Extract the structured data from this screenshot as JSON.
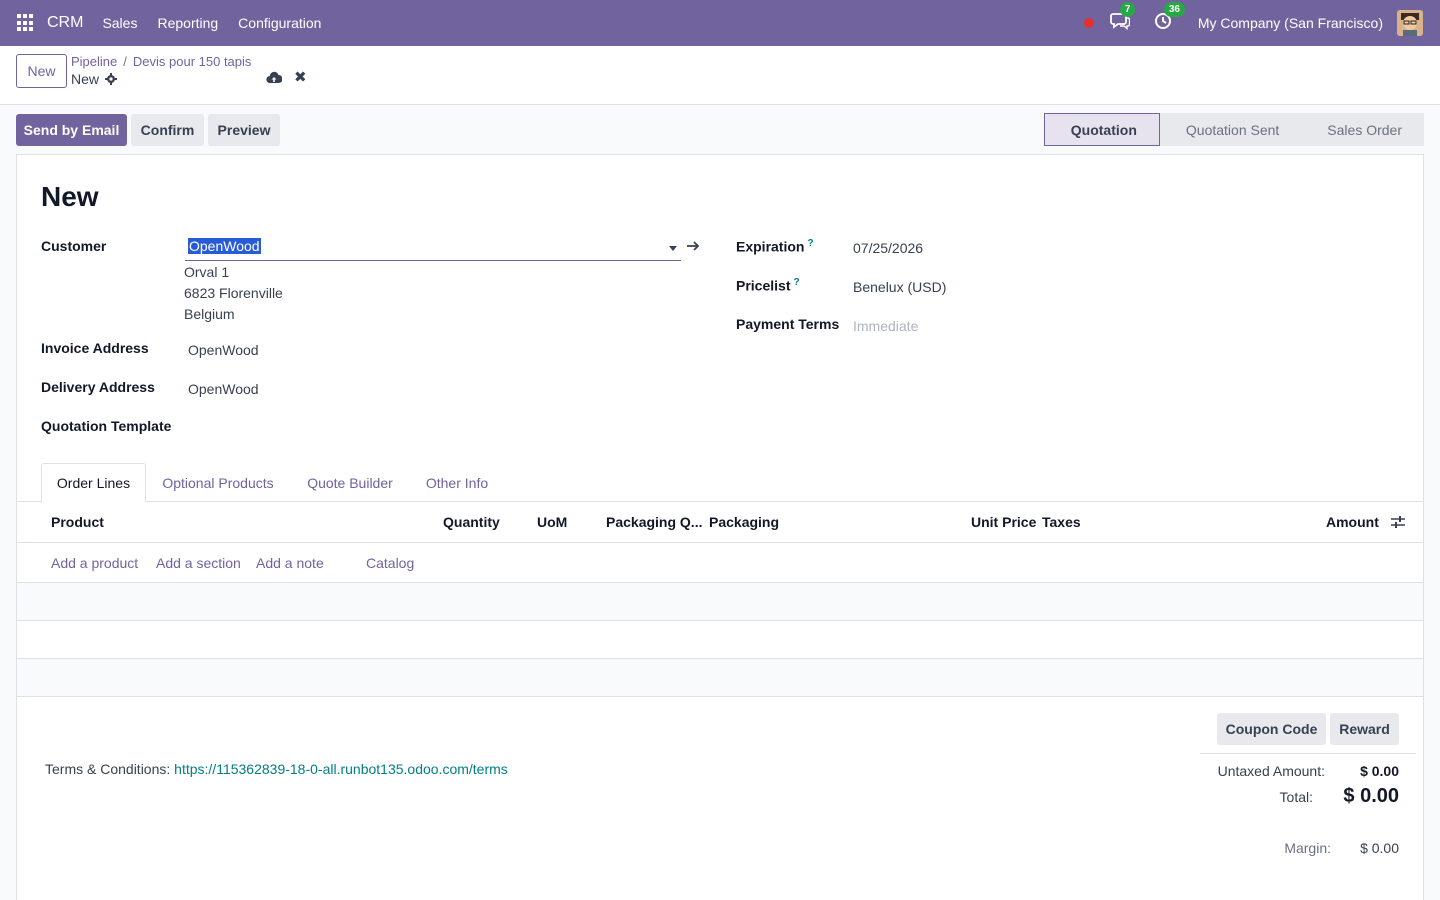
{
  "navbar": {
    "app_name": "CRM",
    "menus": [
      "Sales",
      "Reporting",
      "Configuration"
    ],
    "messages_count": "7",
    "activities_count": "36",
    "company": "My Company (San Francisco)",
    "accent_color": "#71639e"
  },
  "control": {
    "new_label": "New",
    "breadcrumb": [
      "Pipeline",
      "Devis pour 150 tapis"
    ],
    "record_name": "New"
  },
  "actions": {
    "send_email": "Send by Email",
    "confirm": "Confirm",
    "preview": "Preview"
  },
  "status": {
    "stages": [
      "Quotation",
      "Quotation Sent",
      "Sales Order"
    ],
    "active": "Quotation"
  },
  "form": {
    "title": "New",
    "customer_label": "Customer",
    "customer_value": "OpenWood",
    "address": [
      "Orval 1",
      "6823 Florenville",
      "Belgium"
    ],
    "invoice_label": "Invoice Address",
    "invoice_value": "OpenWood",
    "delivery_label": "Delivery Address",
    "delivery_value": "OpenWood",
    "template_label": "Quotation Template",
    "expiration_label": "Expiration",
    "expiration_value": "07/25/2026",
    "pricelist_label": "Pricelist",
    "pricelist_value": "Benelux (USD)",
    "payment_label": "Payment Terms",
    "payment_placeholder": "Immediate",
    "help_mark": "?"
  },
  "tabs": [
    "Order Lines",
    "Optional Products",
    "Quote Builder",
    "Other Info"
  ],
  "table": {
    "columns": [
      "Product",
      "Quantity",
      "UoM",
      "Packaging Q...",
      "Packaging",
      "Unit Price",
      "Taxes",
      "Amount"
    ],
    "add_links": [
      "Add a product",
      "Add a section",
      "Add a note",
      "Catalog"
    ]
  },
  "footer": {
    "coupon": "Coupon Code",
    "reward": "Reward",
    "terms_label": "Terms & Conditions:",
    "terms_link": "https://115362839-18-0-all.runbot135.odoo.com/terms",
    "untaxed_label": "Untaxed Amount:",
    "untaxed_value": "$ 0.00",
    "total_label": "Total:",
    "total_value": "$ 0.00",
    "margin_label": "Margin:",
    "margin_value": "$ 0.00"
  }
}
